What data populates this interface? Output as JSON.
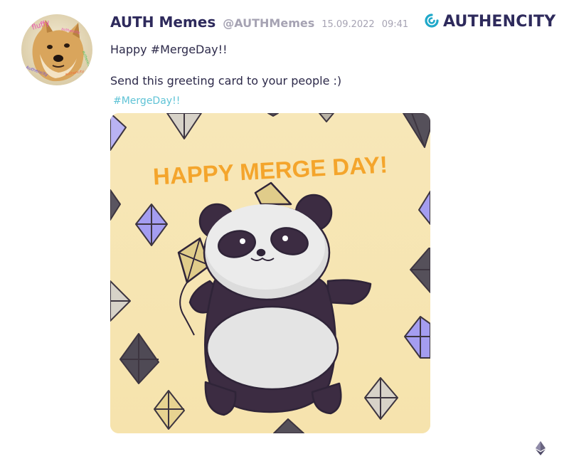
{
  "post": {
    "display_name": "AUTH Memes",
    "handle": "@AUTHMemes",
    "date": "15.09.2022",
    "time": "09:41",
    "text_line1": "Happy #MergeDay!!",
    "text_line2": "Send this greeting card to your people :)",
    "hashtag": "#MergeDay!!"
  },
  "avatar": {
    "stickers": [
      "fluffy",
      "authencity",
      "authencity",
      "Authencity",
      "authencity"
    ]
  },
  "brand": {
    "name": "AUTHENCITY",
    "icon": "authencity-logo-icon"
  },
  "card": {
    "headline": "HAPPY MERGE DAY!"
  },
  "footer": {
    "icon": "ethereum-icon"
  },
  "colors": {
    "name": "#2e2a5c",
    "muted": "#a6a3b3",
    "hashtag": "#5fc3d6",
    "card_bg": "#f7e6b4",
    "headline": "#f4a52c",
    "logo_teal": "#1fa8c9"
  }
}
